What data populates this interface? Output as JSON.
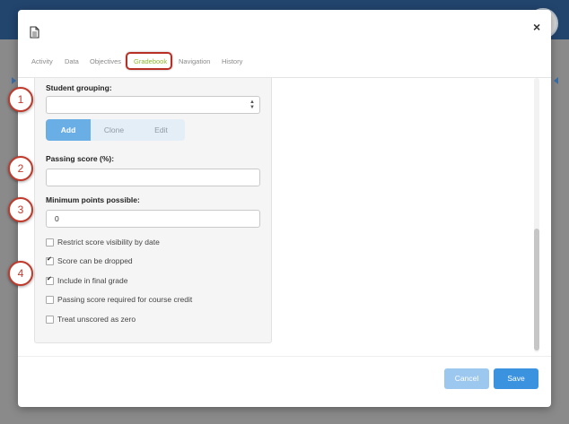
{
  "app": {
    "topbar_indicator": "••"
  },
  "dialog": {
    "icon": "document-icon",
    "close_label": "×",
    "tabs": [
      {
        "label": "Activity",
        "active": false
      },
      {
        "label": "Data",
        "active": false
      },
      {
        "label": "Objectives",
        "active": false
      },
      {
        "label": "Gradebook",
        "active": true
      },
      {
        "label": "Navigation",
        "active": false
      },
      {
        "label": "History",
        "active": false
      }
    ]
  },
  "form": {
    "student_grouping": {
      "label": "Student grouping:",
      "value": ""
    },
    "grouping_actions": [
      {
        "label": "Add",
        "active": true
      },
      {
        "label": "Clone",
        "active": false
      },
      {
        "label": "Edit",
        "active": false
      }
    ],
    "passing_score": {
      "label": "Passing score (%):",
      "value": ""
    },
    "minimum_points": {
      "label": "Minimum points possible:",
      "value": "0"
    },
    "options": [
      {
        "label": "Restrict score visibility by date",
        "checked": false
      },
      {
        "label": "Score can be dropped",
        "checked": true
      },
      {
        "label": "Include in final grade",
        "checked": true
      },
      {
        "label": "Passing score required for course credit",
        "checked": false
      },
      {
        "label": "Treat unscored as zero",
        "checked": false
      }
    ]
  },
  "footer": {
    "cancel_label": "Cancel",
    "save_label": "Save"
  },
  "annotations": [
    "1",
    "2",
    "3",
    "4"
  ],
  "colors": {
    "header": "#22456e",
    "active_tab": "#8fb832",
    "primary_button": "#3b93e0",
    "callout": "#c0392b"
  }
}
